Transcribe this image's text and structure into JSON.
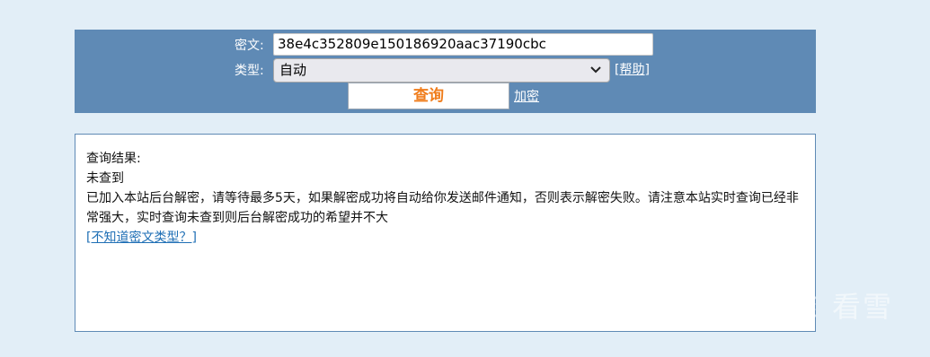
{
  "form": {
    "cipher_label": "密文:",
    "cipher_value": "38e4c352809e150186920aac37190cbc",
    "type_label": "类型:",
    "type_selected": "自动",
    "help_link": "[帮助]",
    "query_button": "查询",
    "encrypt_link": "加密"
  },
  "result": {
    "heading": "查询结果:",
    "status": "未查到",
    "message": "已加入本站后台解密，请等待最多5天，如果解密成功将自动给你发送邮件通知，否则表示解密失败。请注意本站实时查询已经非常强大，实时查询未查到则后台解密成功的希望并不大",
    "type_link": "[不知道密文类型？]"
  },
  "watermark": {
    "text": "看雪",
    "icon": "snowflake-icon"
  },
  "colors": {
    "background": "#e2eef7",
    "panel": "#5f8ab5",
    "button_text": "#f07d1c",
    "link": "#1f6fb5"
  }
}
